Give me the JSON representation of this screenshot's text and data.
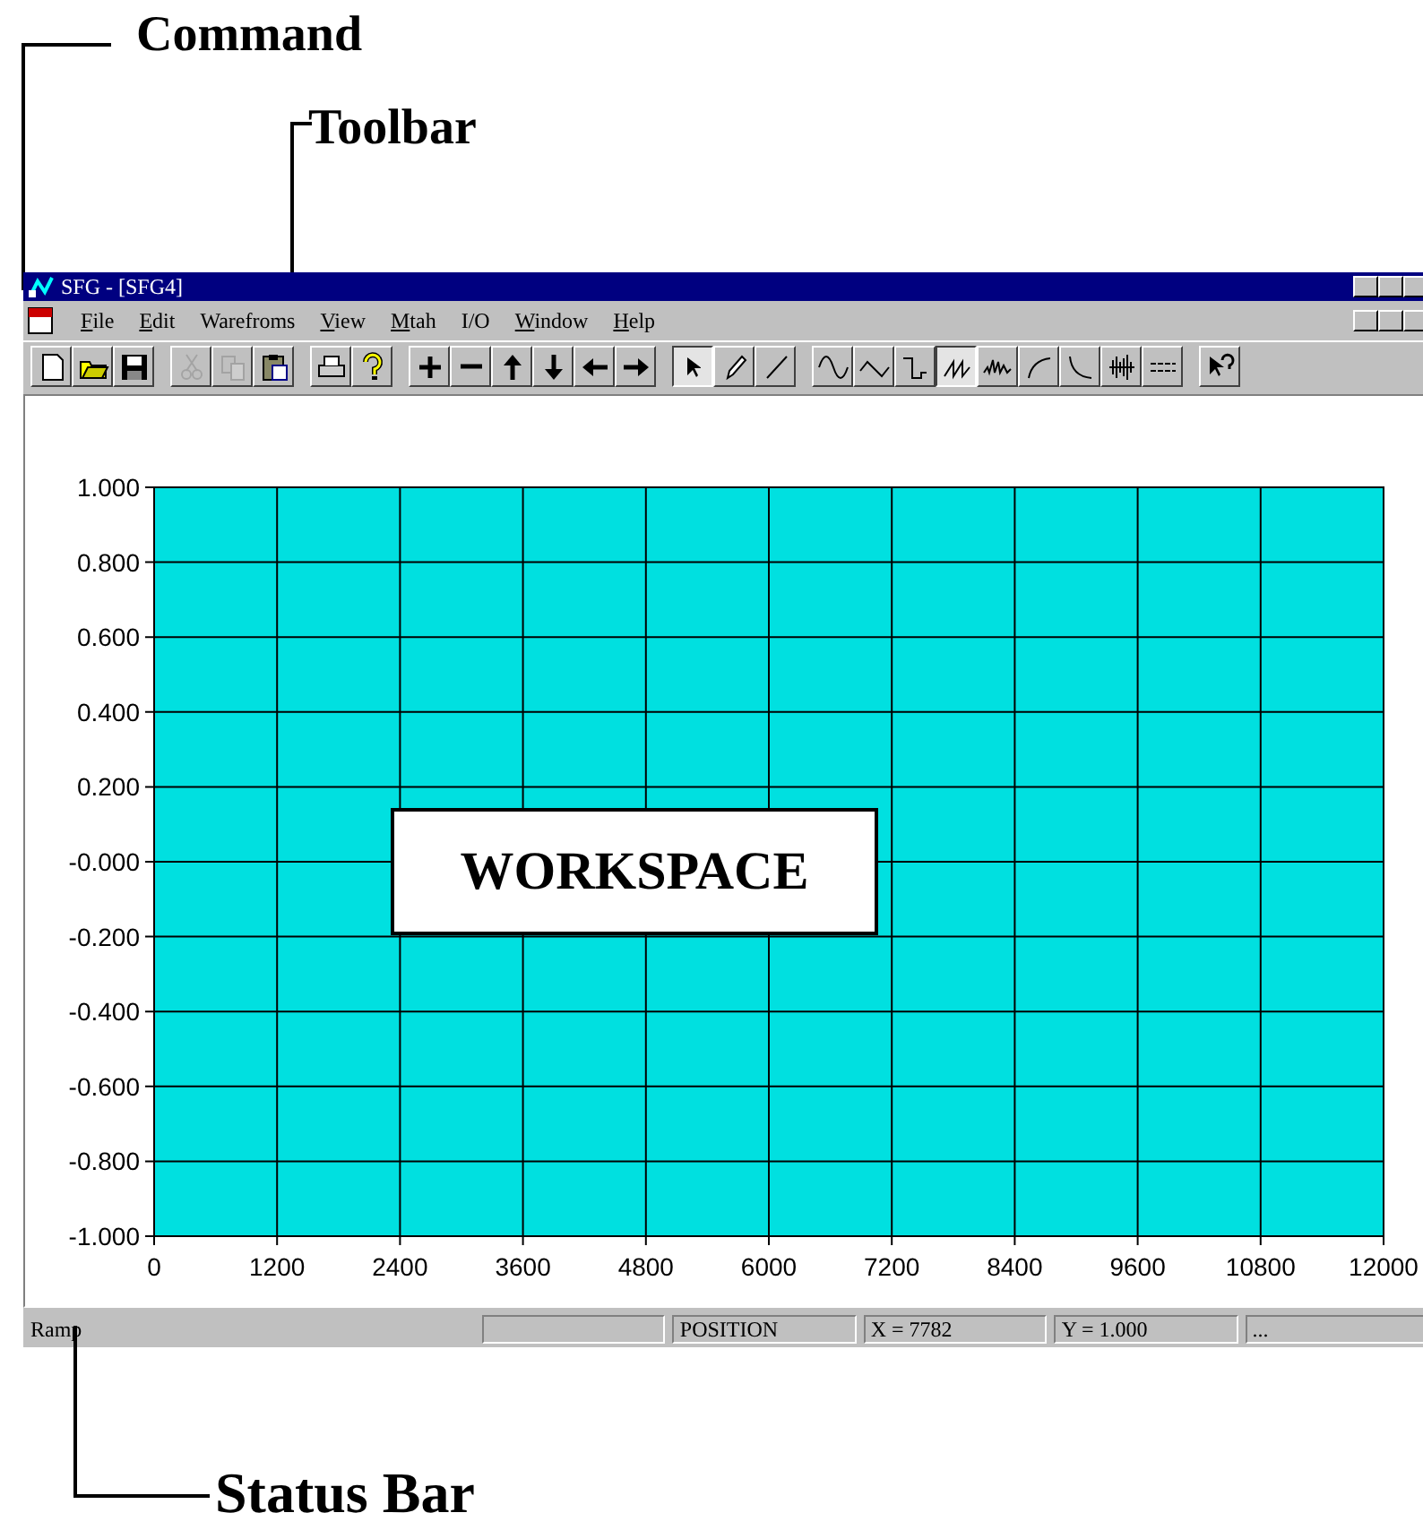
{
  "annotations": {
    "command": "Command",
    "toolbar": "Toolbar",
    "status_bar": "Status Bar"
  },
  "window": {
    "title": "SFG - [SFG4]"
  },
  "menu": [
    {
      "label": "File",
      "underlined": true
    },
    {
      "label": "Edit",
      "underlined": true
    },
    {
      "label": "Warefroms",
      "underlined": false
    },
    {
      "label": "View",
      "underlined": true
    },
    {
      "label": "Mtah",
      "underlined": true
    },
    {
      "label": "I/O",
      "underlined": false
    },
    {
      "label": "Window",
      "underlined": true
    },
    {
      "label": "Help",
      "underlined": true
    }
  ],
  "toolbar": {
    "groups": [
      [
        {
          "pressed": false,
          "disabled": false
        },
        {
          "pressed": false,
          "disabled": false
        },
        {
          "pressed": false,
          "disabled": false
        }
      ],
      [
        {
          "pressed": false,
          "disabled": true
        },
        {
          "pressed": false,
          "disabled": true
        },
        {
          "pressed": false,
          "disabled": false
        }
      ],
      [
        {
          "pressed": false,
          "disabled": false
        },
        {
          "pressed": false,
          "disabled": false
        }
      ],
      [
        {
          "pressed": false,
          "disabled": false
        },
        {
          "pressed": false,
          "disabled": false
        },
        {
          "pressed": false,
          "disabled": false
        },
        {
          "pressed": false,
          "disabled": false
        },
        {
          "pressed": false,
          "disabled": false
        },
        {
          "pressed": false,
          "disabled": false
        }
      ],
      [
        {
          "pressed": true,
          "disabled": false
        },
        {
          "pressed": false,
          "disabled": false
        },
        {
          "pressed": false,
          "disabled": false
        }
      ],
      [
        {
          "pressed": false,
          "disabled": false
        },
        {
          "pressed": false,
          "disabled": false
        },
        {
          "pressed": false,
          "disabled": false
        },
        {
          "pressed": true,
          "disabled": false
        },
        {
          "pressed": false,
          "disabled": false
        },
        {
          "pressed": false,
          "disabled": false
        },
        {
          "pressed": false,
          "disabled": false
        },
        {
          "pressed": false,
          "disabled": false
        },
        {
          "pressed": false,
          "disabled": false
        }
      ],
      [
        {
          "pressed": false,
          "disabled": false
        }
      ]
    ]
  },
  "workspace": {
    "label": "WORKSPACE",
    "chart_data": {
      "type": "line",
      "grid": true,
      "xlim": [
        0,
        12000
      ],
      "ylim": [
        -1,
        1
      ],
      "xticks": [
        0,
        1200,
        2400,
        3600,
        4800,
        6000,
        7200,
        8400,
        9600,
        10800,
        12000
      ],
      "yticks": [
        {
          "value": 1,
          "label": "1.000"
        },
        {
          "value": 0.8,
          "label": "0.800"
        },
        {
          "value": 0.6,
          "label": "0.600"
        },
        {
          "value": 0.4,
          "label": "0.400"
        },
        {
          "value": 0.2,
          "label": "0.200"
        },
        {
          "value": 0,
          "label": "-0.000"
        },
        {
          "value": -0.2,
          "label": "-0.200"
        },
        {
          "value": -0.4,
          "label": "-0.400"
        },
        {
          "value": -0.6,
          "label": "-0.600"
        },
        {
          "value": -0.8,
          "label": "-0.800"
        },
        {
          "value": -1,
          "label": "-1.000"
        }
      ]
    }
  },
  "status_bar": {
    "message": "Ramp",
    "panes": [
      "POSITION",
      "X = 7782",
      "Y = 1.000",
      "..."
    ]
  }
}
